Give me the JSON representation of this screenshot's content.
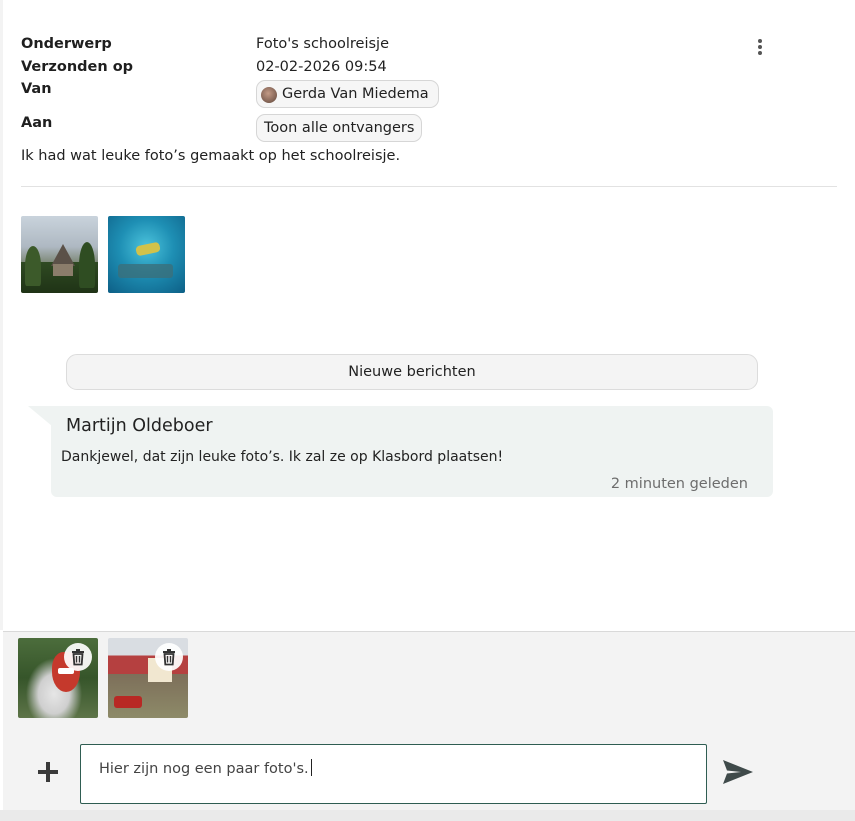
{
  "message": {
    "subject_label": "Onderwerp",
    "subject": "Foto's schoolreisje",
    "sent_label": "Verzonden op",
    "sent": "02-02-2026 09:54",
    "from_label": "Van",
    "from": "Gerda Van Miedema",
    "to_label": "Aan",
    "to_button": "Toon alle ontvangers",
    "body": "Ik had wat leuke foto’s gemaakt op het schoolreisje.",
    "attachments": [
      "church-photo",
      "aquarium-photo"
    ]
  },
  "new_messages_label": "Nieuwe berichten",
  "reply": {
    "author": "Martijn Oldeboer",
    "text": "Dankjewel, dat zijn leuke foto’s. Ik zal ze op Klasbord plaatsen!",
    "time": "2 minuten geleden"
  },
  "composer": {
    "pending_attachments": [
      "mask-sculpture-photo",
      "miniature-village-photo"
    ],
    "input_value": "Hier zijn nog een paar foto's."
  },
  "icons": {
    "menu": "more-vertical-icon",
    "delete": "trash-icon",
    "add": "plus-icon",
    "send": "send-icon"
  },
  "colors": {
    "accent_border": "#2f5d52",
    "bubble_bg": "#eff3f2",
    "chip_bg": "#f6f6f6"
  }
}
